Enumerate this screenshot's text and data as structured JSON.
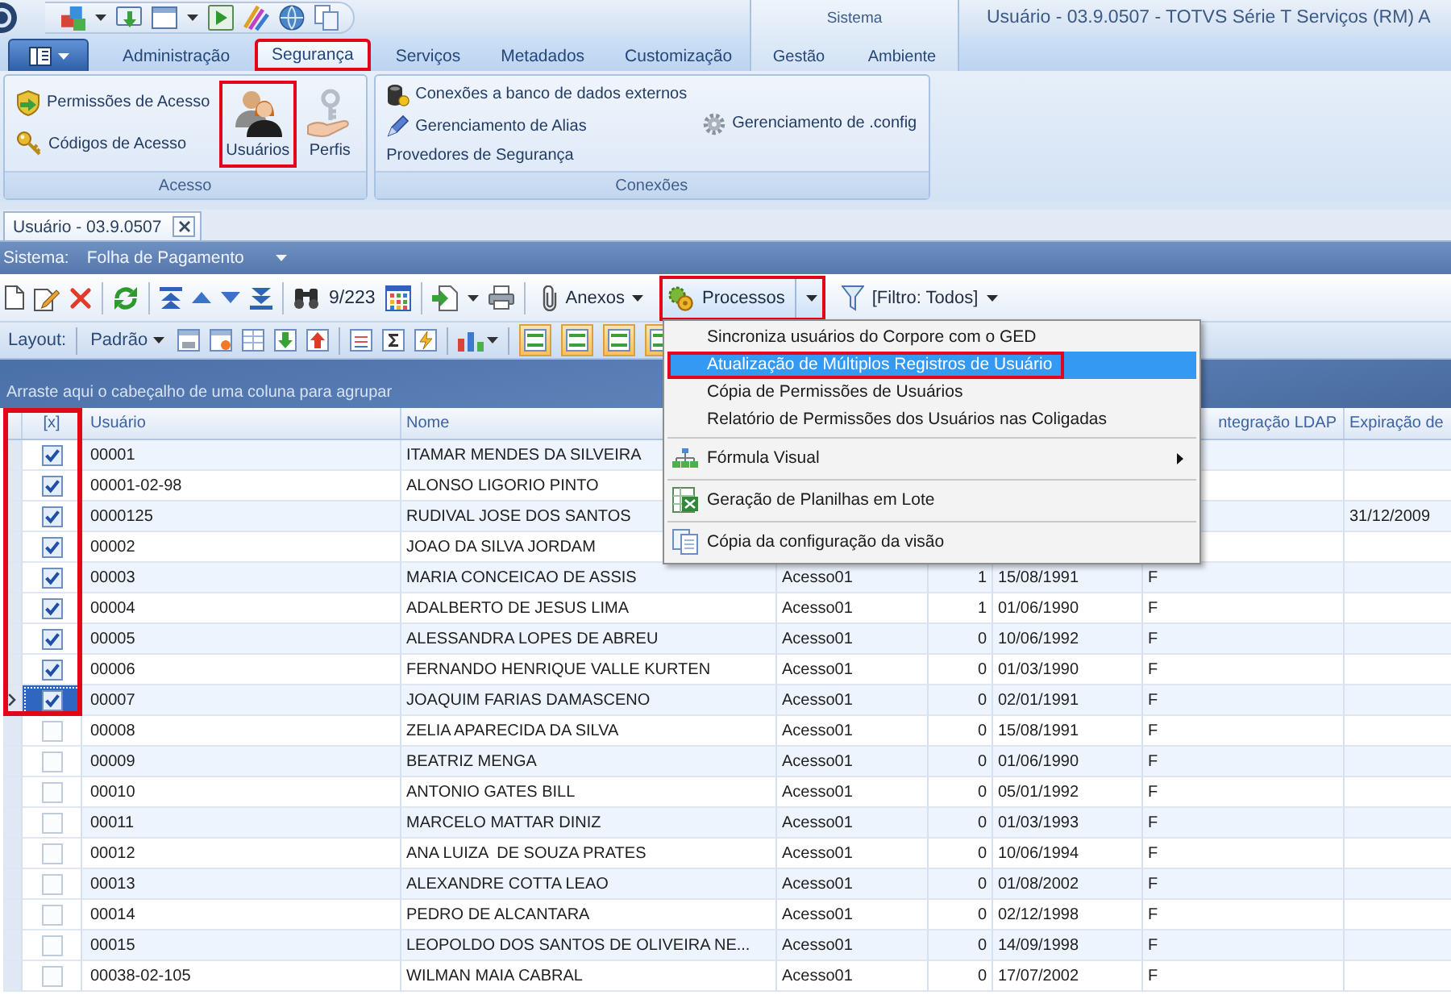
{
  "window": {
    "title": "Usuário - 03.9.0507 - TOTVS Série T Serviços (RM) A"
  },
  "ribbon": {
    "tabs": [
      {
        "label": "Administração",
        "selected": false,
        "outlined": false
      },
      {
        "label": "Segurança",
        "selected": true,
        "outlined": true
      },
      {
        "label": "Serviços",
        "selected": false,
        "outlined": false
      },
      {
        "label": "Metadados",
        "selected": false,
        "outlined": false
      },
      {
        "label": "Customização",
        "selected": false,
        "outlined": false
      }
    ],
    "contextual_group": {
      "label": "Sistema",
      "tabs": [
        {
          "label": "Gestão",
          "selected": false
        },
        {
          "label": "Ambiente",
          "selected": false
        }
      ]
    },
    "groups": [
      {
        "label": "Acesso",
        "columns": [
          [
            {
              "kind": "small",
              "label": "Permissões de Acesso",
              "outlined": false
            },
            {
              "kind": "small",
              "label": "Códigos de Acesso",
              "outlined": false
            }
          ],
          [
            {
              "kind": "large",
              "label": "Usuários",
              "outlined": true
            }
          ],
          [
            {
              "kind": "large",
              "label": "Perfis",
              "outlined": false
            }
          ]
        ]
      },
      {
        "label": "Conexões",
        "columns": [
          [
            {
              "kind": "small",
              "label": "Conexões a banco de dados externos",
              "outlined": false
            },
            {
              "kind": "small",
              "label": "Gerenciamento de Alias",
              "outlined": false
            },
            {
              "kind": "small",
              "label": "Provedores de Segurança",
              "outlined": false
            }
          ],
          [
            {
              "kind": "small",
              "label": "Gerenciamento de .config",
              "outlined": false
            }
          ]
        ]
      }
    ]
  },
  "document_tabs": [
    {
      "label": "Usuário - 03.9.0507",
      "selected": true
    }
  ],
  "system_filter": {
    "label": "Sistema:",
    "value": "Folha de Pagamento"
  },
  "toolbar": {
    "record_counter": "9/223",
    "buttons": [
      {
        "kind": "dropdown",
        "label": "Anexos",
        "expanded": false,
        "outlined": false
      },
      {
        "kind": "split",
        "label": "Processos",
        "expanded": true,
        "outlined": true
      },
      {
        "kind": "dropdown",
        "label": "[Filtro: Todos]",
        "expanded": false,
        "outlined": false
      }
    ]
  },
  "layout_toolbar": {
    "label": "Layout:",
    "layout_button": "Padrão",
    "toggles": [
      {
        "on": true
      },
      {
        "on": true
      },
      {
        "on": true
      },
      {
        "on": true
      }
    ]
  },
  "group_panel": {
    "hint": "Arraste aqui o cabeçalho de uma coluna para agrupar"
  },
  "table": {
    "checked_rows_outlined": true,
    "columns": {
      "checkbox": "[x]",
      "usuario": "Usuário",
      "nome": "Nome",
      "column_7": "ntegração LDAP",
      "column_8": "Expiração de"
    },
    "rows": [
      {
        "checked": true,
        "current": false,
        "usuario": "00001",
        "nome": "ITAMAR MENDES DA SILVEIRA"
      },
      {
        "checked": true,
        "current": false,
        "usuario": "00001-02-98",
        "nome": "ALONSO LIGORIO PINTO"
      },
      {
        "checked": true,
        "current": false,
        "usuario": "0000125",
        "nome": "RUDIVAL JOSE DOS SANTOS",
        "column_8": "31/12/2009"
      },
      {
        "checked": true,
        "current": false,
        "usuario": "00002",
        "nome": "JOAO DA SILVA JORDAM"
      },
      {
        "checked": true,
        "current": false,
        "usuario": "00003",
        "nome": "MARIA CONCEICAO DE ASSIS",
        "column_4": "Acesso01",
        "column_5": "1",
        "column_6": "15/08/1991",
        "column_7": "F"
      },
      {
        "checked": true,
        "current": false,
        "usuario": "00004",
        "nome": "ADALBERTO DE JESUS LIMA",
        "column_4": "Acesso01",
        "column_5": "1",
        "column_6": "01/06/1990",
        "column_7": "F"
      },
      {
        "checked": true,
        "current": false,
        "usuario": "00005",
        "nome": "ALESSANDRA LOPES DE ABREU",
        "column_4": "Acesso01",
        "column_5": "0",
        "column_6": "10/06/1992",
        "column_7": "F"
      },
      {
        "checked": true,
        "current": false,
        "usuario": "00006",
        "nome": "FERNANDO HENRIQUE VALLE KURTEN",
        "column_4": "Acesso01",
        "column_5": "0",
        "column_6": "01/03/1990",
        "column_7": "F"
      },
      {
        "checked": true,
        "current": true,
        "usuario": "00007",
        "nome": "JOAQUIM FARIAS DAMASCENO",
        "column_4": "Acesso01",
        "column_5": "0",
        "column_6": "02/01/1991",
        "column_7": "F"
      },
      {
        "checked": false,
        "current": false,
        "usuario": "00008",
        "nome": "ZELIA APARECIDA DA SILVA",
        "column_4": "Acesso01",
        "column_5": "0",
        "column_6": "15/08/1991",
        "column_7": "F"
      },
      {
        "checked": false,
        "current": false,
        "usuario": "00009",
        "nome": "BEATRIZ MENGA",
        "column_4": "Acesso01",
        "column_5": "0",
        "column_6": "01/06/1990",
        "column_7": "F"
      },
      {
        "checked": false,
        "current": false,
        "usuario": "00010",
        "nome": "ANTONIO GATES BILL",
        "column_4": "Acesso01",
        "column_5": "0",
        "column_6": "05/01/1992",
        "column_7": "F"
      },
      {
        "checked": false,
        "current": false,
        "usuario": "00011",
        "nome": "MARCELO MATTAR DINIZ",
        "column_4": "Acesso01",
        "column_5": "0",
        "column_6": "01/03/1993",
        "column_7": "F"
      },
      {
        "checked": false,
        "current": false,
        "usuario": "00012",
        "nome": "ANA LUIZA  DE SOUZA PRATES",
        "column_4": "Acesso01",
        "column_5": "0",
        "column_6": "10/06/1994",
        "column_7": "F"
      },
      {
        "checked": false,
        "current": false,
        "usuario": "00013",
        "nome": "ALEXANDRE COTTA LEAO",
        "column_4": "Acesso01",
        "column_5": "0",
        "column_6": "01/08/2002",
        "column_7": "F"
      },
      {
        "checked": false,
        "current": false,
        "usuario": "00014",
        "nome": "PEDRO DE ALCANTARA",
        "column_4": "Acesso01",
        "column_5": "0",
        "column_6": "02/12/1998",
        "column_7": "F"
      },
      {
        "checked": false,
        "current": false,
        "usuario": "00015",
        "nome": "LEOPOLDO DOS SANTOS DE OLIVEIRA NE...",
        "column_4": "Acesso01",
        "column_5": "0",
        "column_6": "14/09/1998",
        "column_7": "F"
      },
      {
        "checked": false,
        "current": false,
        "usuario": "00038-02-105",
        "nome": "WILMAN MAIA CABRAL",
        "column_4": "Acesso01",
        "column_5": "0",
        "column_6": "17/07/2002",
        "column_7": "F"
      }
    ]
  },
  "processes_menu": {
    "items": [
      {
        "kind": "item",
        "label": "Sincroniza usuários do Corpore com o GED",
        "selected": false,
        "outlined": false
      },
      {
        "kind": "item",
        "label": "Atualização de Múltiplos Registros de Usuário",
        "selected": true,
        "outlined": true
      },
      {
        "kind": "item",
        "label": "Cópia de Permissões de Usuários",
        "selected": false,
        "outlined": false
      },
      {
        "kind": "item",
        "label": "Relatório de Permissões dos Usuários nas Coligadas",
        "selected": false,
        "outlined": false
      },
      {
        "kind": "separator"
      },
      {
        "kind": "submenu",
        "label": "Fórmula Visual",
        "selected": false,
        "outlined": false
      },
      {
        "kind": "separator"
      },
      {
        "kind": "item",
        "label": "Geração de Planilhas em Lote",
        "selected": false,
        "outlined": false
      },
      {
        "kind": "separator"
      },
      {
        "kind": "item",
        "label": "Cópia da configuração da visão",
        "selected": false,
        "outlined": false
      }
    ]
  }
}
